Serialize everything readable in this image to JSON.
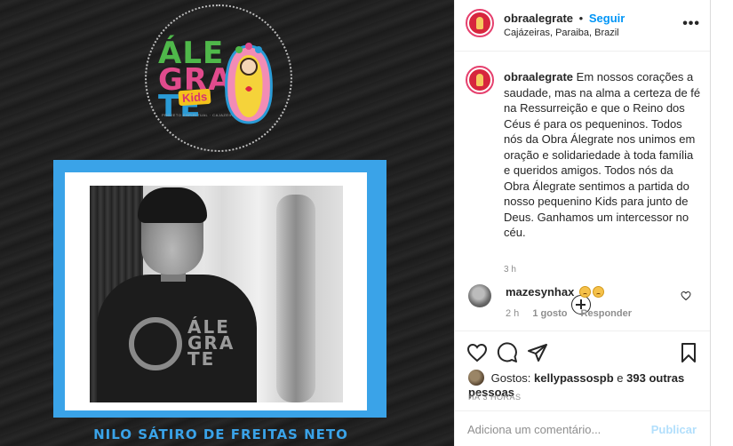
{
  "post_image": {
    "logo_line1": "ÁLE",
    "logo_line2": "GRA",
    "logo_line3": "TE",
    "logo_kids": "Kids",
    "logo_sub": "PROJETO ESPIRITUAL · CAJAZEIRAS-PB",
    "shirt_text_1": "ÁLE",
    "shirt_text_2": "GRA",
    "shirt_text_3": "TE",
    "name_caption": "NILO SÁTIRO DE FREITAS NETO",
    "colors": {
      "frame_blue": "#3aa3e8",
      "logo_green": "#4fb84a",
      "logo_pink": "#e14b8c",
      "logo_blue": "#2a9bd6"
    }
  },
  "header": {
    "username": "obraalegrate",
    "separator": "•",
    "follow_label": "Seguir",
    "location": "Cajázeiras, Paraiba, Brazil",
    "more_icon": "more-horizontal-icon"
  },
  "caption": {
    "username": "obraalegrate",
    "text": "Em nossos corações a saudade, mas na alma a certeza de fé na Ressurreição e que o Reino dos Céus é para os pequeninos. Todos nós da Obra Álegrate nos unimos em oração e solidariedade à toda família e queridos amigos. Todos nós da Obra Álegrate sentimos a partida do nosso pequenino Kids para junto de Deus. Ganhamos um intercessor no céu.",
    "time": "3 h"
  },
  "load_more_icon": "plus-circle-icon",
  "reply": {
    "username": "mazesynhax",
    "emojis": [
      "sad-face-emoji",
      "sad-face-emoji"
    ],
    "time": "2 h",
    "likes": "1 gosto",
    "reply_label": "Responder"
  },
  "actions": {
    "icons": [
      "heart-icon",
      "comment-icon",
      "share-icon",
      "bookmark-icon"
    ],
    "likes_prefix": "Gostos:",
    "liked_by": "kellypassospb",
    "likes_joiner": "e",
    "others": "393 outras pessoas",
    "date": "HÁ 3 HORAS"
  },
  "add_comment": {
    "placeholder": "Adiciona um comentário...",
    "publish_label": "Publicar"
  },
  "colors": {
    "link_blue": "#0095f6",
    "muted": "#8e8e8e",
    "publish_disabled": "#b2dffc"
  }
}
